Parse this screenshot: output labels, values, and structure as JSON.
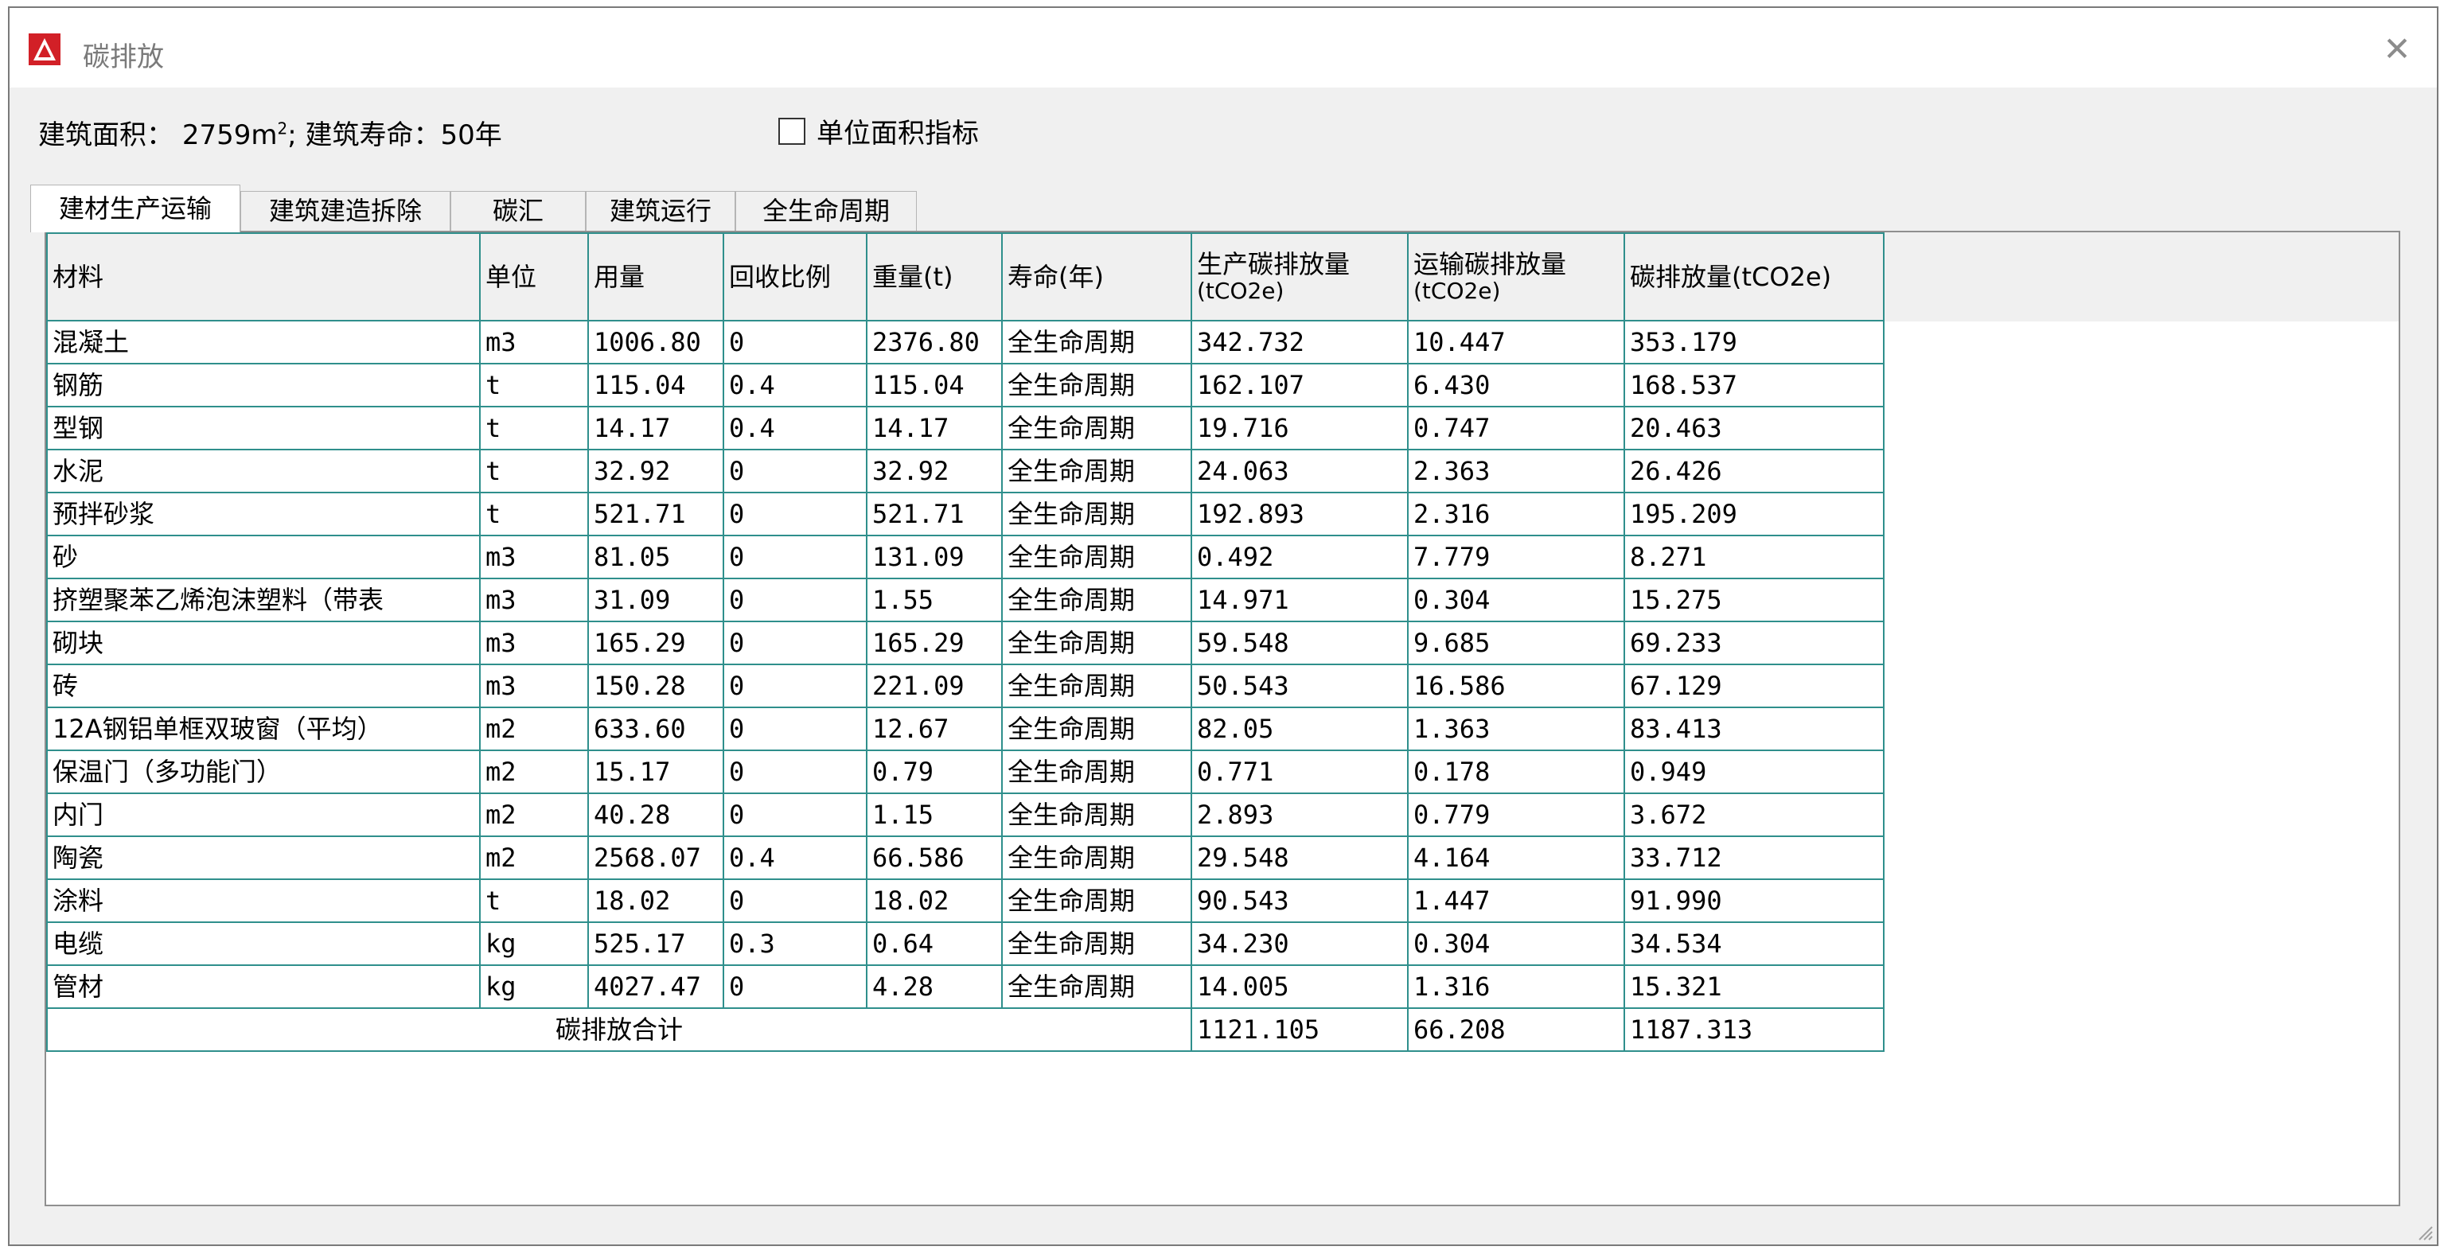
{
  "window": {
    "title": "碳排放",
    "close_symbol": "✕",
    "icon": "autocad-logo-icon"
  },
  "info": {
    "area_label": "建筑面积：",
    "area_value": "2759",
    "area_unit_base": "m",
    "area_unit_sup": "2",
    "separator": ";",
    "life_label": "建筑寿命：",
    "life_value": "50年",
    "checkbox_label": "单位面积指标",
    "checkbox_checked": false
  },
  "tabs": [
    {
      "label": "建材生产运输",
      "active": true
    },
    {
      "label": "建筑建造拆除",
      "active": false
    },
    {
      "label": "碳汇",
      "active": false
    },
    {
      "label": "建筑运行",
      "active": false
    },
    {
      "label": "全生命周期",
      "active": false
    }
  ],
  "table": {
    "headers": [
      {
        "main": "材料",
        "sub": ""
      },
      {
        "main": "单位",
        "sub": ""
      },
      {
        "main": "用量",
        "sub": ""
      },
      {
        "main": "回收比例",
        "sub": ""
      },
      {
        "main": "重量(t)",
        "sub": ""
      },
      {
        "main": "寿命(年)",
        "sub": ""
      },
      {
        "main": "生产碳排放量",
        "sub": "(tCO2e)"
      },
      {
        "main": "运输碳排放量",
        "sub": "(tCO2e)"
      },
      {
        "main": "碳排放量(tCO2e)",
        "sub": ""
      }
    ],
    "rows": [
      [
        "混凝土",
        "m3",
        "1006.80",
        "0",
        "2376.80",
        "全生命周期",
        "342.732",
        "10.447",
        "353.179"
      ],
      [
        "钢筋",
        "t",
        "115.04",
        "0.4",
        "115.04",
        "全生命周期",
        "162.107",
        "6.430",
        "168.537"
      ],
      [
        "型钢",
        "t",
        "14.17",
        "0.4",
        "14.17",
        "全生命周期",
        "19.716",
        "0.747",
        "20.463"
      ],
      [
        "水泥",
        "t",
        "32.92",
        "0",
        "32.92",
        "全生命周期",
        "24.063",
        "2.363",
        "26.426"
      ],
      [
        "预拌砂浆",
        "t",
        "521.71",
        "0",
        "521.71",
        "全生命周期",
        "192.893",
        "2.316",
        "195.209"
      ],
      [
        "砂",
        "m3",
        "81.05",
        "0",
        "131.09",
        "全生命周期",
        "0.492",
        "7.779",
        "8.271"
      ],
      [
        "挤塑聚苯乙烯泡沫塑料（带表",
        "m3",
        "31.09",
        "0",
        "1.55",
        "全生命周期",
        "14.971",
        "0.304",
        "15.275"
      ],
      [
        "砌块",
        "m3",
        "165.29",
        "0",
        "165.29",
        "全生命周期",
        "59.548",
        "9.685",
        "69.233"
      ],
      [
        "砖",
        "m3",
        "150.28",
        "0",
        "221.09",
        "全生命周期",
        "50.543",
        "16.586",
        "67.129"
      ],
      [
        "12A钢铝单框双玻窗（平均）",
        "m2",
        "633.60",
        "0",
        "12.67",
        "全生命周期",
        "82.05",
        "1.363",
        "83.413"
      ],
      [
        "保温门（多功能门）",
        "m2",
        "15.17",
        "0",
        "0.79",
        "全生命周期",
        "0.771",
        "0.178",
        "0.949"
      ],
      [
        "内门",
        "m2",
        "40.28",
        "0",
        "1.15",
        "全生命周期",
        "2.893",
        "0.779",
        "3.672"
      ],
      [
        "陶瓷",
        "m2",
        "2568.07",
        "0.4",
        "66.586",
        "全生命周期",
        "29.548",
        "4.164",
        "33.712"
      ],
      [
        "涂料",
        "t",
        "18.02",
        "0",
        "18.02",
        "全生命周期",
        "90.543",
        "1.447",
        "91.990"
      ],
      [
        "电缆",
        "kg",
        "525.17",
        "0.3",
        "0.64",
        "全生命周期",
        "34.230",
        "0.304",
        "34.534"
      ],
      [
        "管材",
        "kg",
        "4027.47",
        "0",
        "4.28",
        "全生命周期",
        "14.005",
        "1.316",
        "15.321"
      ]
    ],
    "total": {
      "label": "碳排放合计",
      "production": "1121.105",
      "transport": "66.208",
      "sum": "1187.313"
    }
  },
  "colors": {
    "grid_line": "#2f8f8c",
    "icon_red": "#d22027"
  }
}
